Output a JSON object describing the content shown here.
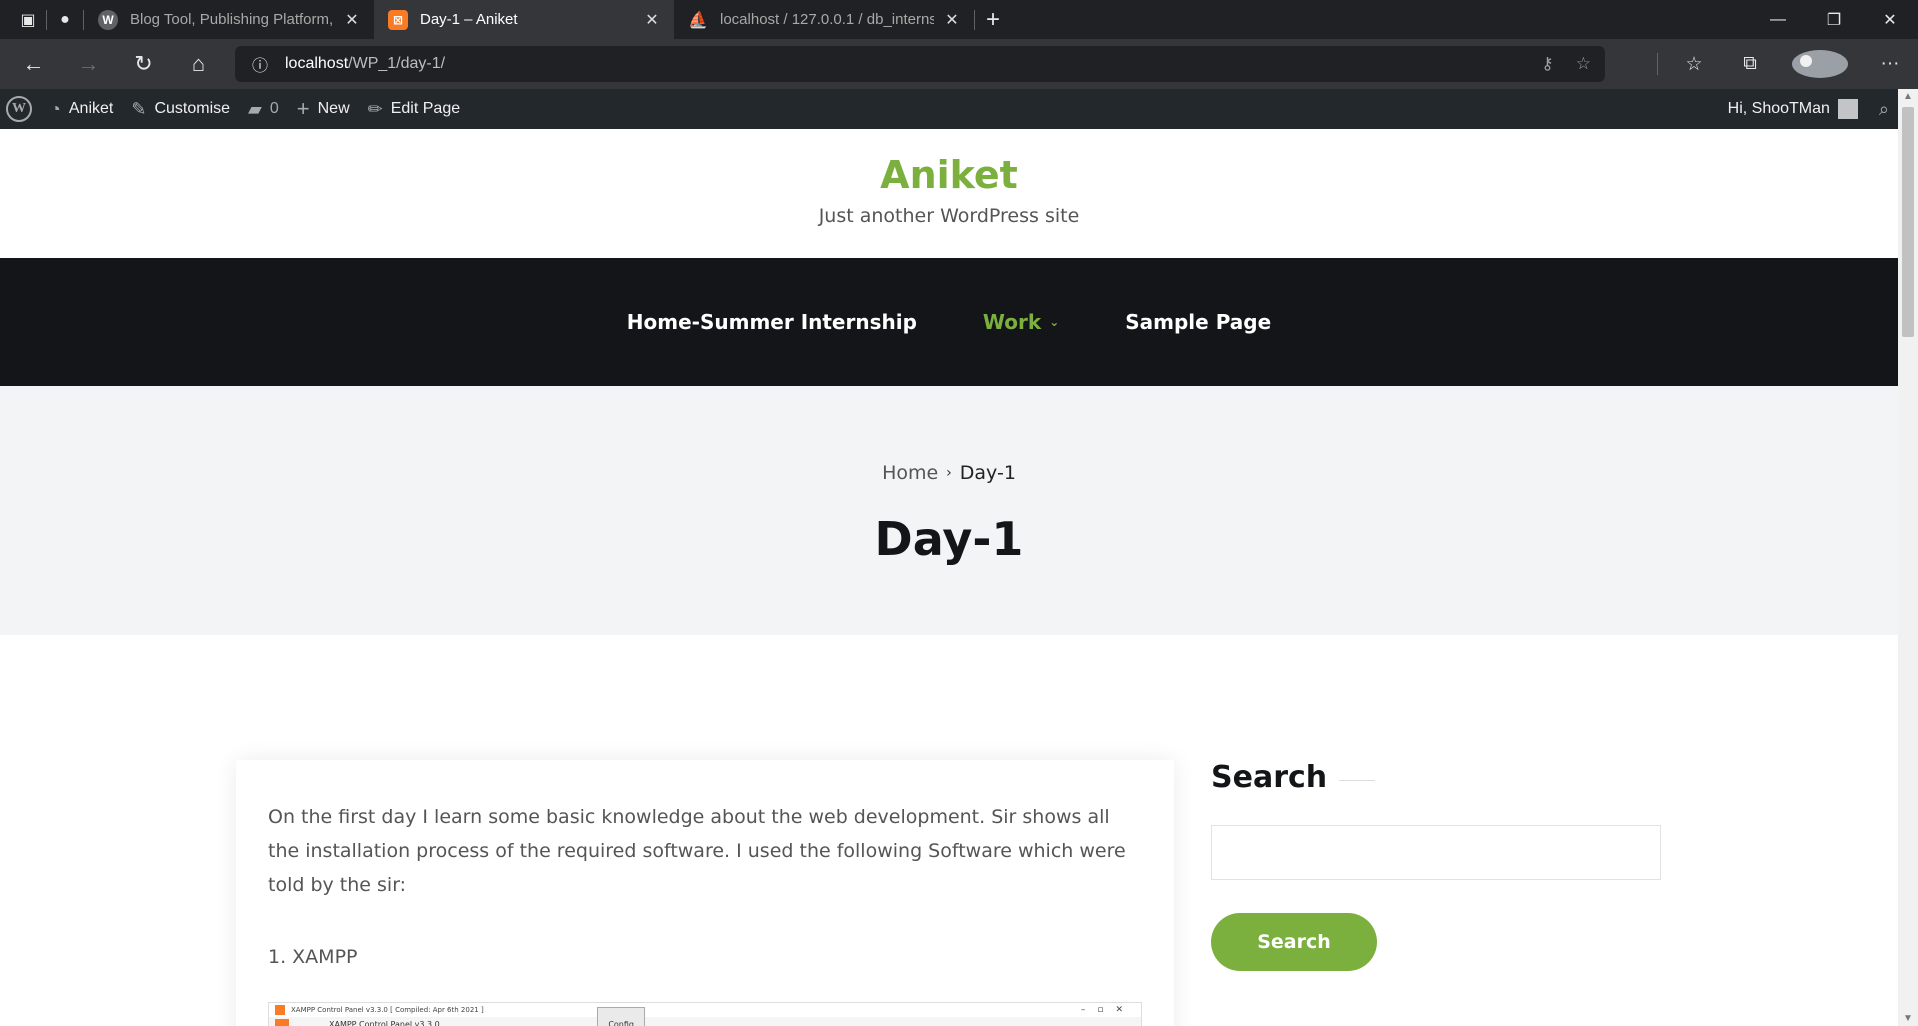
{
  "browser": {
    "tabs": [
      {
        "title": "Blog Tool, Publishing Platform, and",
        "active": false
      },
      {
        "title": "Day-1 – Aniket",
        "active": true
      },
      {
        "title": "localhost / 127.0.0.1 / db_interns",
        "active": false
      }
    ],
    "url_host": "localhost",
    "url_path": "/WP_1/day-1/"
  },
  "adminbar": {
    "site_name": "Aniket",
    "customise": "Customise",
    "comments_count": "0",
    "new_label": "New",
    "edit_page": "Edit Page",
    "greeting": "Hi, ShooTMan"
  },
  "site": {
    "title": "Aniket",
    "tagline": "Just another WordPress site",
    "accent_color": "#7bb03f"
  },
  "nav": {
    "items": [
      {
        "label": "Home-Summer Internship"
      },
      {
        "label": "Work"
      },
      {
        "label": "Sample Page"
      }
    ]
  },
  "hero": {
    "breadcrumb_home": "Home",
    "breadcrumb_current": "Day-1",
    "page_title": "Day-1"
  },
  "content": {
    "paragraph": "On the first day I learn some basic knowledge about the web development. Sir shows all the installation process of the required software. I used the following Software which were told by the sir:",
    "list_item_1": "1. XAMPP",
    "xampp_caption": "XAMPP Control Panel v3.3.0  [ Compiled: Apr 6th 2021 ]",
    "xampp_heading": "XAMPP Control Panel v3.3.0",
    "xampp_config": "Config"
  },
  "sidebar": {
    "widget_title": "Search",
    "search_button": "Search"
  }
}
